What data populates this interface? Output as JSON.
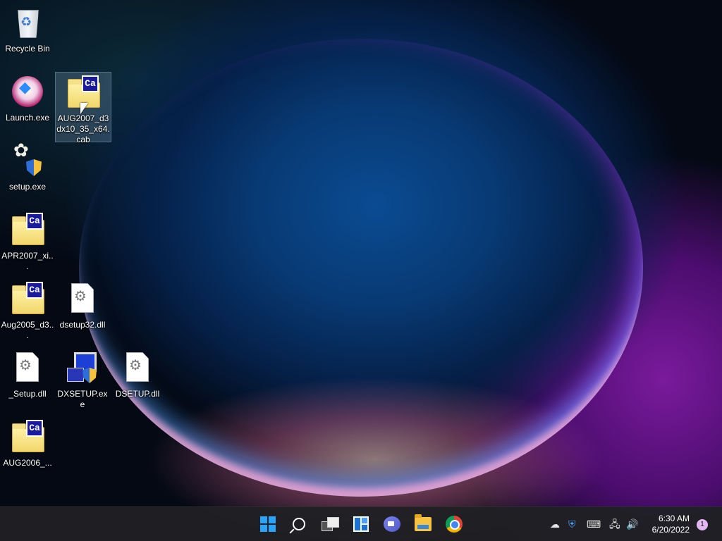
{
  "desktop": {
    "icons": [
      {
        "label": "Recycle Bin",
        "icon": "recycle-bin-icon"
      },
      {
        "label": "Launch.exe",
        "icon": "gem-launcher-icon"
      },
      {
        "label": "AUG2007_d3dx10_35_x64.cab",
        "icon": "cab-file-icon"
      },
      {
        "label": "setup.exe",
        "icon": "setup-installer-icon"
      },
      {
        "label": "APR2007_xi...",
        "icon": "cab-file-icon"
      },
      {
        "label": "Aug2005_d3...",
        "icon": "cab-file-icon"
      },
      {
        "label": "dsetup32.dll",
        "icon": "dll-file-icon"
      },
      {
        "label": "_Setup.dll",
        "icon": "dll-file-icon"
      },
      {
        "label": "DXSETUP.exe",
        "icon": "dxsetup-icon"
      },
      {
        "label": "DSETUP.dll",
        "icon": "dll-file-icon"
      },
      {
        "label": "AUG2006_...",
        "icon": "cab-file-icon"
      }
    ],
    "cab_glyph": "Ca"
  },
  "taskbar": {
    "clock_time": "6:30 AM",
    "clock_date": "6/20/2022",
    "notification_count": "1",
    "accent": "#2aa3ff"
  }
}
